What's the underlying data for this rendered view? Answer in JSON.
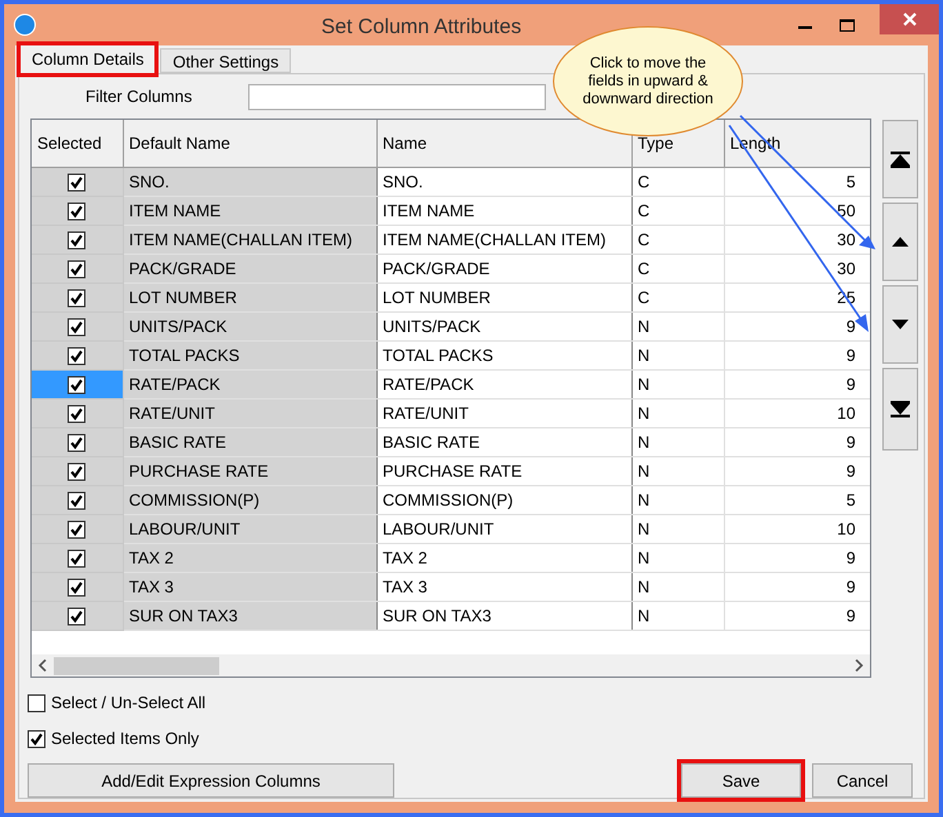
{
  "window": {
    "title": "Set Column Attributes"
  },
  "tabs": [
    {
      "label": "Column Details",
      "selected": true,
      "highlighted": true
    },
    {
      "label": "Other Settings",
      "selected": false,
      "highlighted": false
    }
  ],
  "filter": {
    "label": "Filter Columns"
  },
  "table": {
    "columns": [
      "Selected",
      "Default Name",
      "Name",
      "Type",
      "Length"
    ],
    "rows": [
      {
        "checked": true,
        "selected": false,
        "default_name": "SNO.",
        "name": "SNO.",
        "type": "C",
        "length": "5"
      },
      {
        "checked": true,
        "selected": false,
        "default_name": "ITEM NAME",
        "name": "ITEM NAME",
        "type": "C",
        "length": "50"
      },
      {
        "checked": true,
        "selected": false,
        "default_name": "ITEM NAME(CHALLAN ITEM)",
        "name": "ITEM NAME(CHALLAN ITEM)",
        "type": "C",
        "length": "30"
      },
      {
        "checked": true,
        "selected": false,
        "default_name": "PACK/GRADE",
        "name": "PACK/GRADE",
        "type": "C",
        "length": "30"
      },
      {
        "checked": true,
        "selected": false,
        "default_name": "LOT NUMBER",
        "name": "LOT NUMBER",
        "type": "C",
        "length": "25"
      },
      {
        "checked": true,
        "selected": false,
        "default_name": "UNITS/PACK",
        "name": "UNITS/PACK",
        "type": "N",
        "length": "9"
      },
      {
        "checked": true,
        "selected": false,
        "default_name": "TOTAL PACKS",
        "name": "TOTAL PACKS",
        "type": "N",
        "length": "9"
      },
      {
        "checked": true,
        "selected": true,
        "default_name": "RATE/PACK",
        "name": "RATE/PACK",
        "type": "N",
        "length": "9"
      },
      {
        "checked": true,
        "selected": false,
        "default_name": "RATE/UNIT",
        "name": "RATE/UNIT",
        "type": "N",
        "length": "10"
      },
      {
        "checked": true,
        "selected": false,
        "default_name": "BASIC RATE",
        "name": "BASIC RATE",
        "type": "N",
        "length": "9"
      },
      {
        "checked": true,
        "selected": false,
        "default_name": "PURCHASE RATE",
        "name": "PURCHASE RATE",
        "type": "N",
        "length": "9"
      },
      {
        "checked": true,
        "selected": false,
        "default_name": "COMMISSION(P)",
        "name": "COMMISSION(P)",
        "type": "N",
        "length": "5"
      },
      {
        "checked": true,
        "selected": false,
        "default_name": "LABOUR/UNIT",
        "name": "LABOUR/UNIT",
        "type": "N",
        "length": "10"
      },
      {
        "checked": true,
        "selected": false,
        "default_name": "TAX 2",
        "name": "TAX 2",
        "type": "N",
        "length": "9"
      },
      {
        "checked": true,
        "selected": false,
        "default_name": "TAX 3",
        "name": "TAX 3",
        "type": "N",
        "length": "9"
      },
      {
        "checked": true,
        "selected": false,
        "default_name": "SUR ON TAX3",
        "name": "SUR ON TAX3",
        "type": "N",
        "length": "9"
      }
    ]
  },
  "options": [
    {
      "label": "Select / Un-Select All",
      "checked": false
    },
    {
      "label": "Selected Items Only",
      "checked": true
    }
  ],
  "buttons": [
    {
      "label": "Add/Edit Expression Columns",
      "highlighted": false
    },
    {
      "label": "Save",
      "highlighted": true
    },
    {
      "label": "Cancel",
      "highlighted": false
    }
  ],
  "callout": {
    "text": "Click to move the fields in upward & downward direction"
  }
}
